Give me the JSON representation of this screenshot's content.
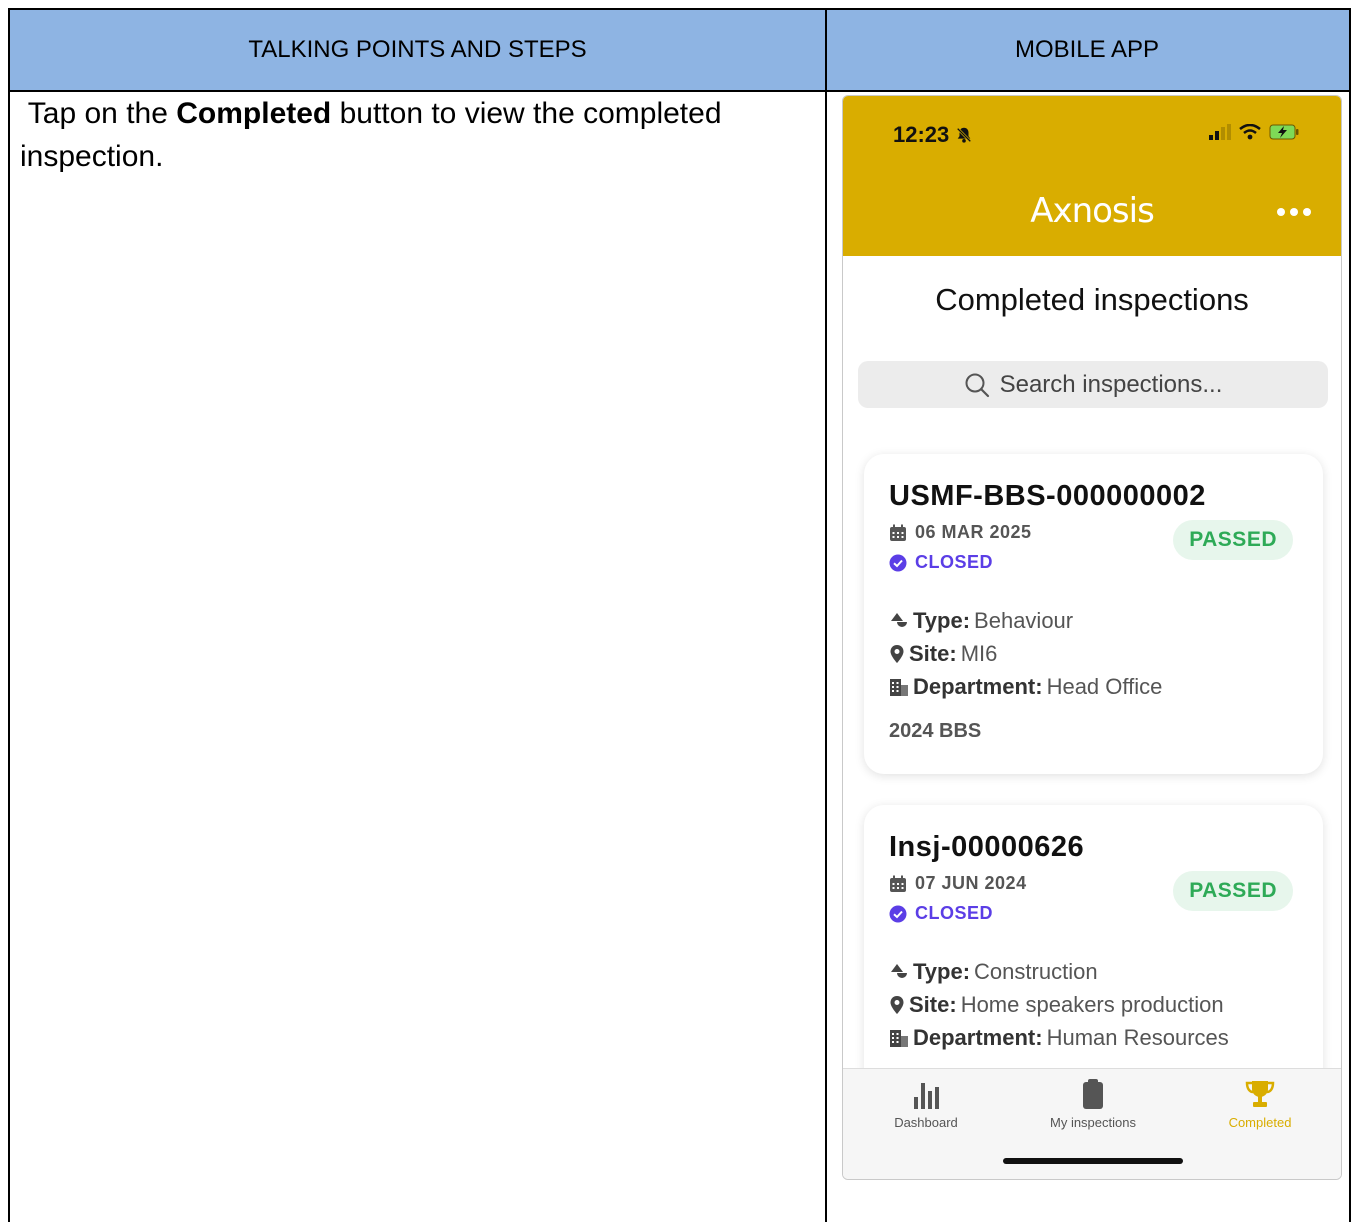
{
  "table": {
    "header_left": "TALKING POINTS AND STEPS",
    "header_right": "MOBILE APP",
    "step": {
      "prefix": " Tap on the ",
      "highlight": "Completed",
      "suffix": " button to view the completed inspection."
    }
  },
  "phone": {
    "status_bar": {
      "time": "12:23"
    },
    "header": {
      "logo_text": "Axnosis"
    },
    "page_title": "Completed inspections",
    "search": {
      "placeholder": "Search inspections..."
    },
    "cards": [
      {
        "id": "USMF-BBS-000000002",
        "date": "06 MAR 2025",
        "status": "CLOSED",
        "result": "PASSED",
        "type_label": "Type:",
        "type": "Behaviour",
        "site_label": "Site:",
        "site": "MI6",
        "department_label": "Department:",
        "department": "Head Office",
        "tag": "2024 BBS"
      },
      {
        "id": "Insj-00000626",
        "date": "07 JUN 2024",
        "status": "CLOSED",
        "result": "PASSED",
        "type_label": "Type:",
        "type": "Construction",
        "site_label": "Site:",
        "site": "Home speakers production",
        "department_label": "Department:",
        "department": "Human Resources"
      }
    ],
    "tabs": [
      {
        "label": "Dashboard",
        "icon": "bar-chart-icon"
      },
      {
        "label": "My inspections",
        "icon": "clipboard-icon"
      },
      {
        "label": "Completed",
        "icon": "trophy-icon",
        "active": true
      }
    ],
    "colors": {
      "brand": "#d9ad00",
      "status": "#5b3ee6",
      "passed": "#2eaa57",
      "table_header": "#8eb4e3"
    }
  }
}
